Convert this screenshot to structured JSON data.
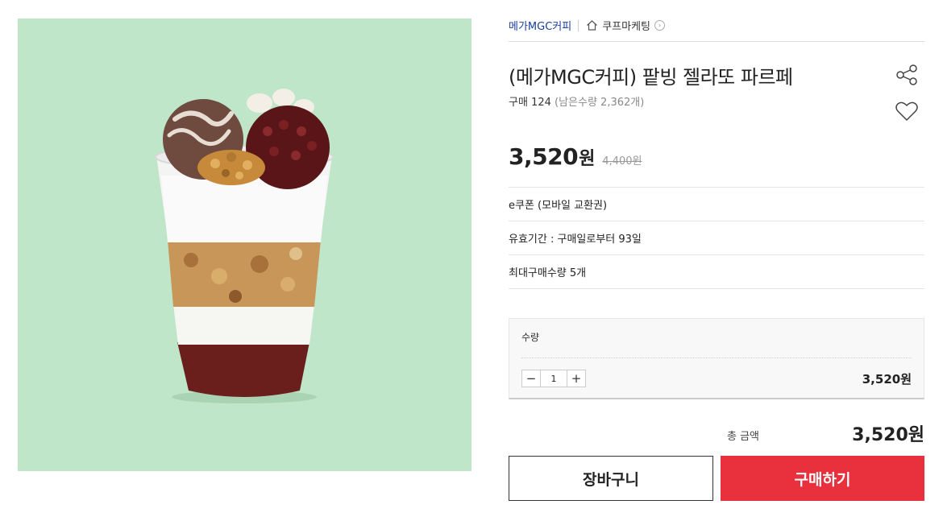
{
  "breadcrumb": {
    "brand": "메가MGC커피",
    "category": "쿠프마케팅"
  },
  "product": {
    "title": "(메가MGC커피) 팥빙 젤라또 파르페",
    "sales": "구매 124",
    "remaining": "(남은수량 2,362개)",
    "price": "3,520",
    "price_unit": "원",
    "original_price": "4,400원",
    "image_icon": "parfait-cup-image",
    "image_bg": "#bfe6c8"
  },
  "specs": [
    "e쿠폰 (모바일 교환권)",
    "유효기간 : 구매일로부터 93일",
    "최대구매수량 5개"
  ],
  "quantity": {
    "label": "수량",
    "value": "1",
    "minus": "−",
    "plus": "+",
    "line_total": "3,520원"
  },
  "total": {
    "label": "총 금액",
    "amount": "3,520원"
  },
  "buttons": {
    "cart": "장바구니",
    "buy": "구매하기",
    "buy_color": "#e8313c"
  },
  "icons": {
    "share": "share-icon",
    "wishlist": "heart-icon",
    "home": "home-icon",
    "chevron": "chevron-right-icon"
  }
}
